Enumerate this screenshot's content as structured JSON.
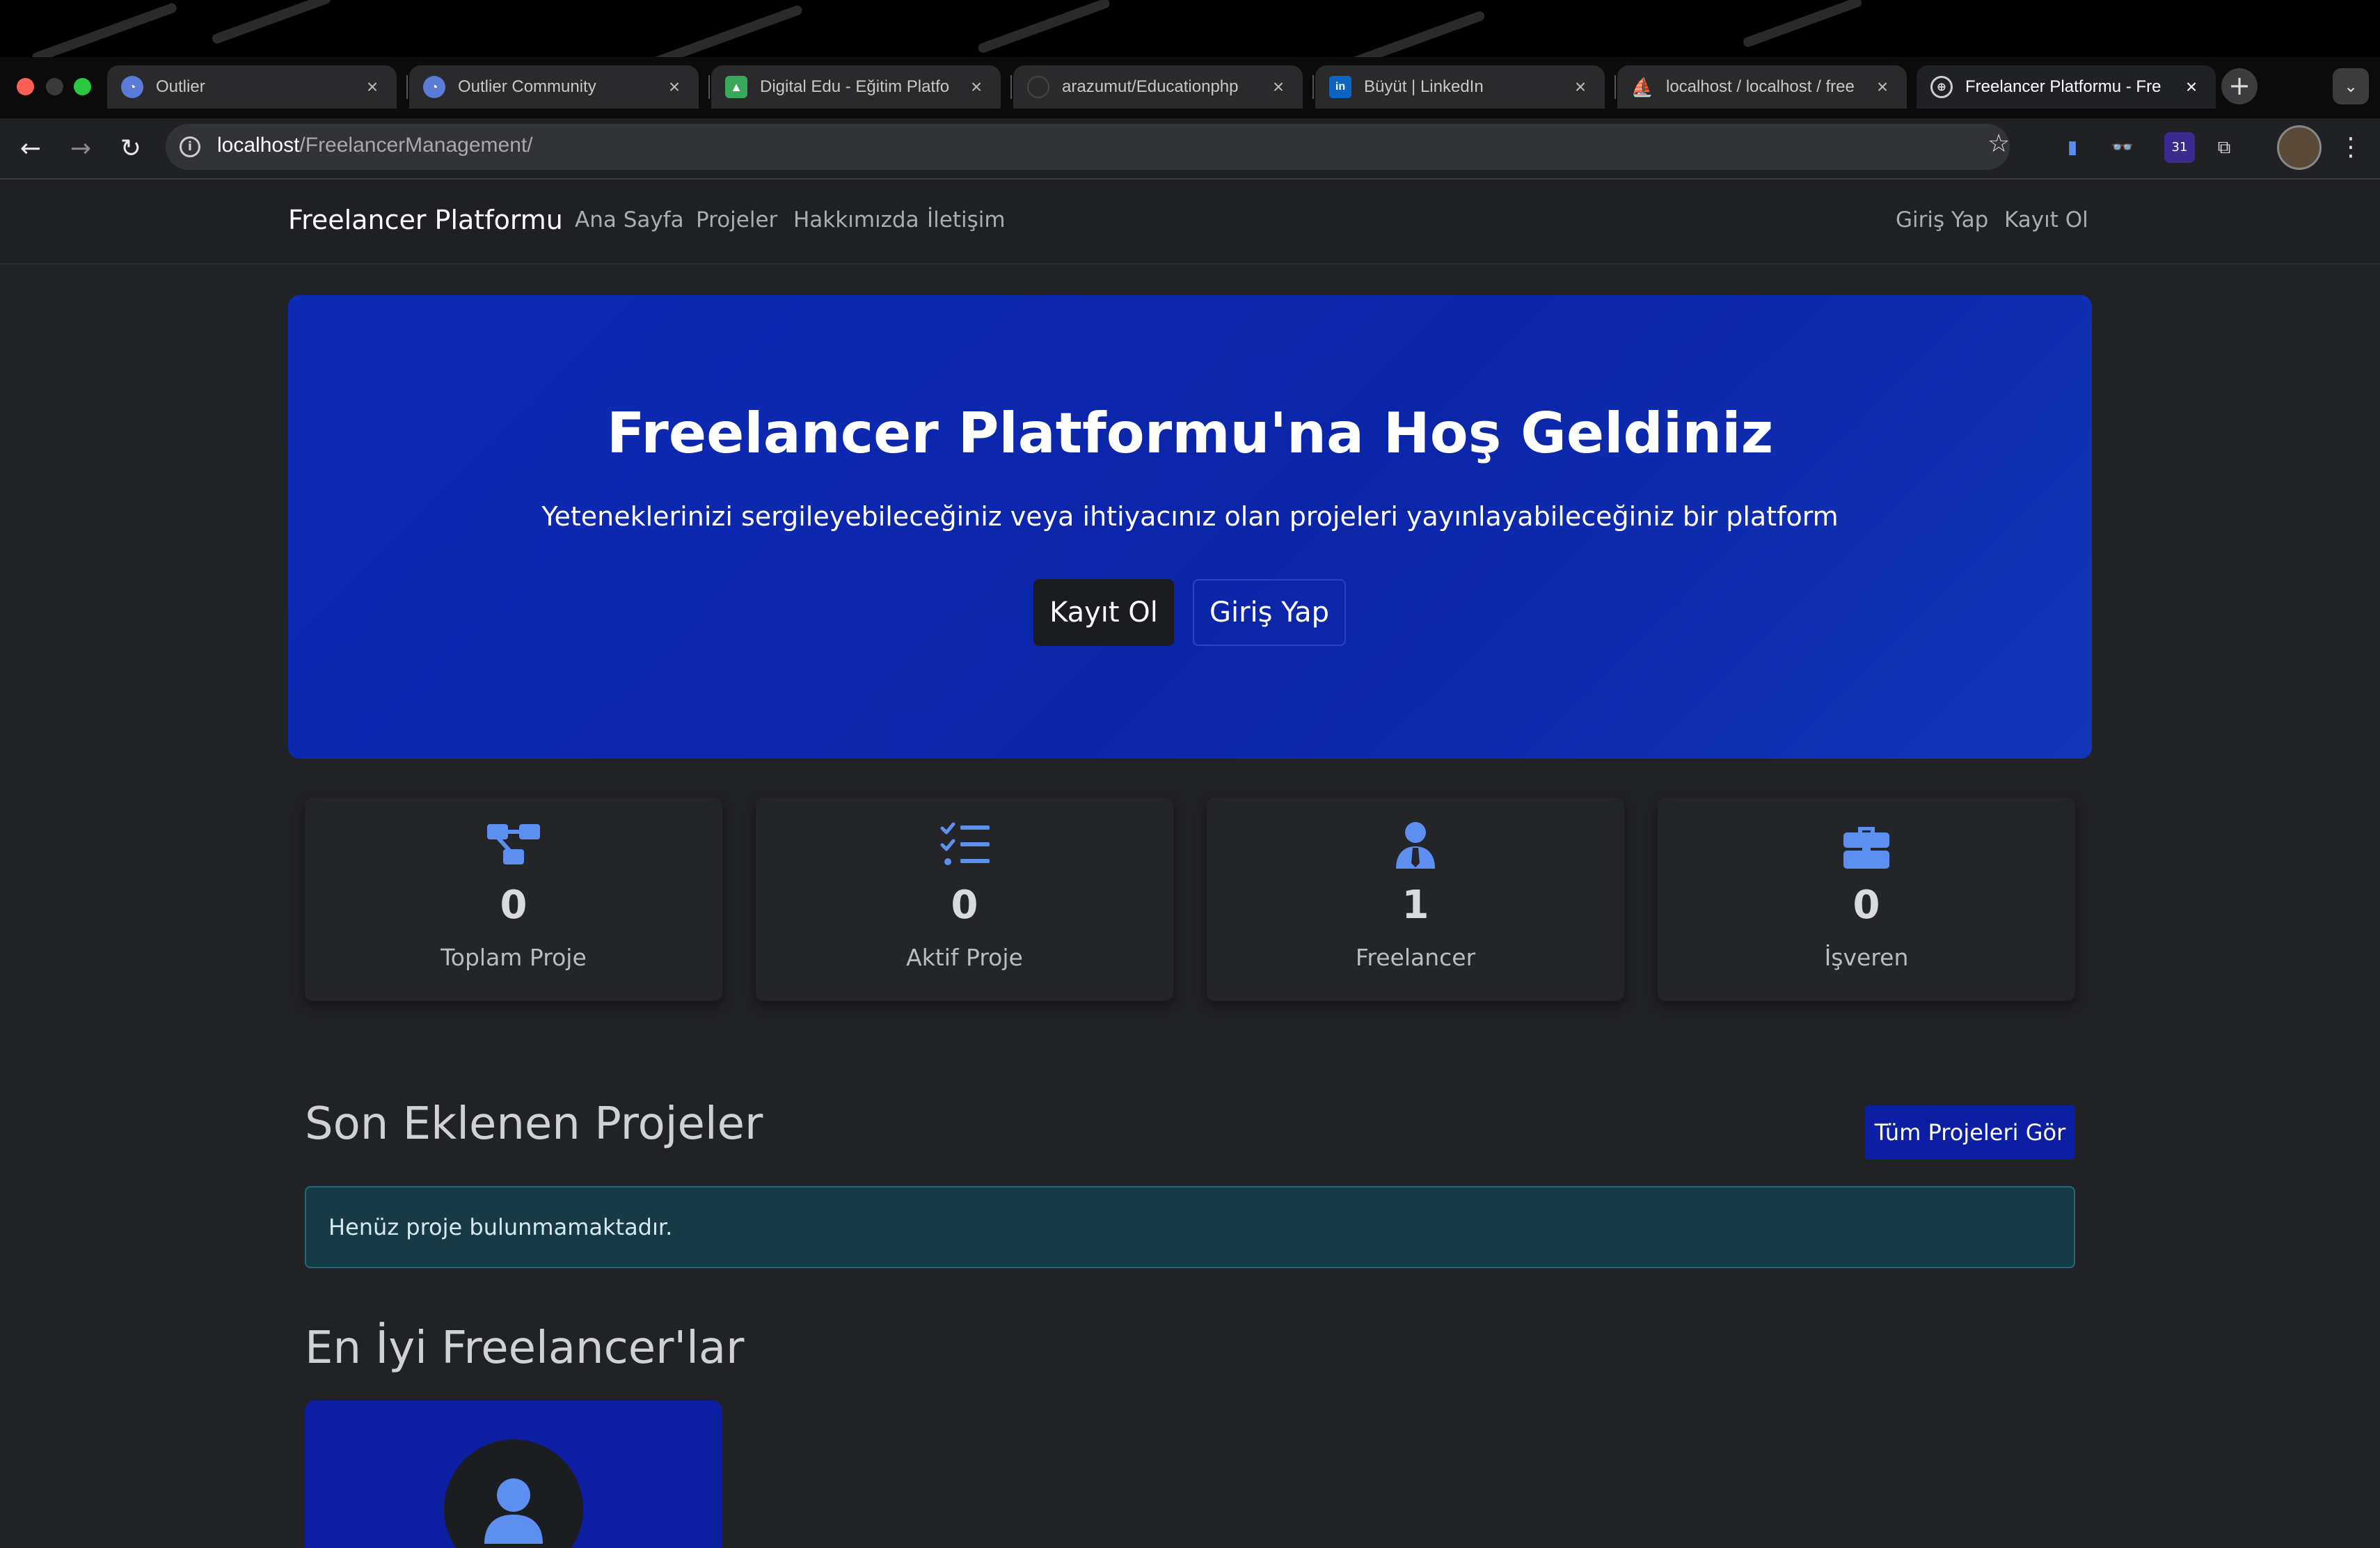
{
  "browser": {
    "tabs": [
      {
        "title": "Outlier",
        "active": false
      },
      {
        "title": "Outlier Community",
        "active": false
      },
      {
        "title": "Digital Edu - Eğitim Platfo",
        "active": false
      },
      {
        "title": "arazumut/Educationphp",
        "active": false
      },
      {
        "title": "Büyüt | LinkedIn",
        "active": false
      },
      {
        "title": "localhost / localhost / free",
        "active": false
      },
      {
        "title": "Freelancer Platformu - Fre",
        "active": true
      }
    ],
    "new_tab_label": "+",
    "tab_search_label": "⌄",
    "url_host": "localhost",
    "url_path": "/FreelancerManagement/",
    "calendar_badge": "31"
  },
  "navbar": {
    "brand": "Freelancer Platformu",
    "links": [
      "Ana Sayfa",
      "Projeler",
      "Hakkımızda",
      "İletişim"
    ],
    "auth": {
      "login": "Giriş Yap",
      "register": "Kayıt Ol"
    }
  },
  "hero": {
    "title": "Freelancer Platformu'na Hoş Geldiniz",
    "subtitle": "Yeteneklerinizi sergileyebileceğiniz veya ihtiyacınız olan projeleri yayınlayabileceğiniz bir platform",
    "register_label": "Kayıt Ol",
    "login_label": "Giriş Yap"
  },
  "stats": [
    {
      "icon": "project-diagram-icon",
      "value": "0",
      "label": "Toplam Proje"
    },
    {
      "icon": "tasks-icon",
      "value": "0",
      "label": "Aktif Proje"
    },
    {
      "icon": "user-tie-icon",
      "value": "1",
      "label": "Freelancer"
    },
    {
      "icon": "briefcase-icon",
      "value": "0",
      "label": "İşveren"
    }
  ],
  "recent_projects": {
    "title": "Son Eklenen Projeler",
    "view_all_label": "Tüm Projeleri Gör",
    "empty_message": "Henüz proje bulunmamaktadır."
  },
  "best_freelancers": {
    "title": "En İyi Freelancer'lar"
  },
  "colors": {
    "accent": "#0c1fa3",
    "hero_gradient_start": "#0d2bb5",
    "icon_blue": "#5d8ff0",
    "page_bg": "#212225",
    "alert_bg": "#173b45"
  }
}
